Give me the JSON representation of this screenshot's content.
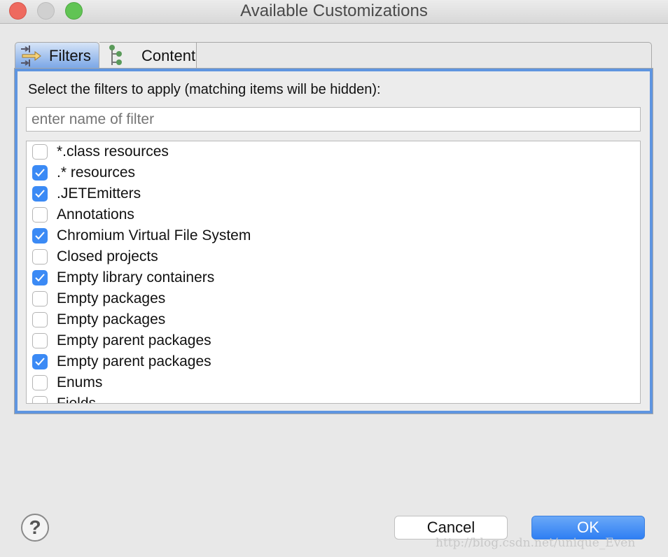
{
  "window": {
    "title": "Available Customizations",
    "traffic_lights": {
      "close": "#ee6a5f",
      "minimize": "#d0d0d0",
      "zoom": "#61c454"
    }
  },
  "tabs": [
    {
      "label": "Filters",
      "icon": "filter-arrows-icon",
      "active": true
    },
    {
      "label": "Content",
      "icon": "tree-icon",
      "active": false
    }
  ],
  "filters": {
    "instruction": "Select the filters to apply (matching items will be hidden):",
    "search": {
      "value": "",
      "placeholder": "enter name of filter"
    },
    "items": [
      {
        "label": "*.class resources",
        "checked": false
      },
      {
        "label": ".* resources",
        "checked": true
      },
      {
        "label": ".JETEmitters",
        "checked": true
      },
      {
        "label": "Annotations",
        "checked": false
      },
      {
        "label": "Chromium Virtual File System",
        "checked": true
      },
      {
        "label": "Closed projects",
        "checked": false
      },
      {
        "label": "Empty library containers",
        "checked": true
      },
      {
        "label": "Empty packages",
        "checked": false
      },
      {
        "label": "Empty packages",
        "checked": false
      },
      {
        "label": "Empty parent packages",
        "checked": false
      },
      {
        "label": "Empty parent packages",
        "checked": true
      },
      {
        "label": "Enums",
        "checked": false
      },
      {
        "label": "Fields",
        "checked": false
      }
    ]
  },
  "footer": {
    "help_icon": "?",
    "cancel_label": "Cancel",
    "ok_label": "OK"
  },
  "watermark": "http://blog.csdn.net/unique_Even",
  "colors": {
    "accent": "#3b8af5",
    "panel_border": "#5f95e0"
  }
}
